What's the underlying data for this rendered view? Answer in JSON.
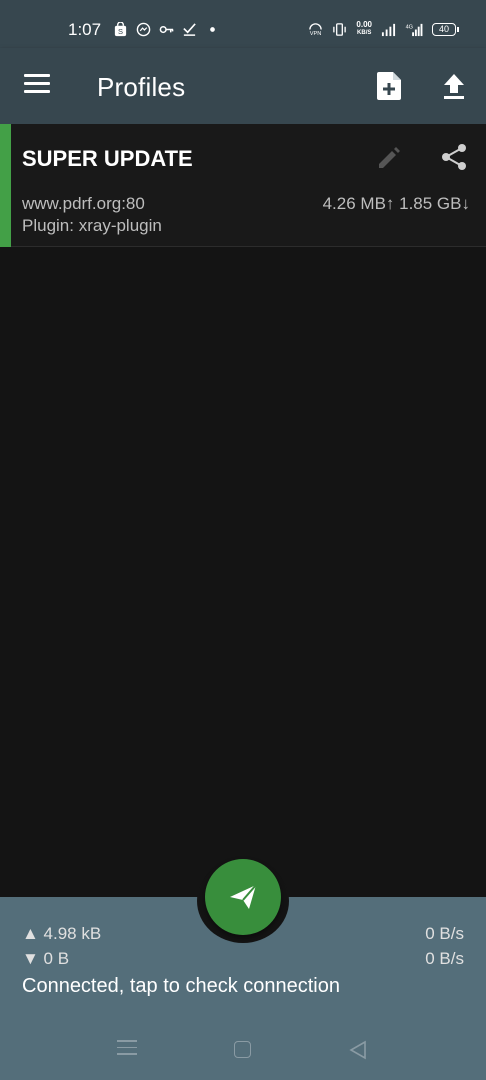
{
  "status_bar": {
    "time": "1:07",
    "net_speed_value": "0.00",
    "net_speed_unit": "KB/S",
    "battery": "40",
    "icons": [
      "bag-icon",
      "messenger-icon",
      "key-icon",
      "check-icon",
      "dot-icon",
      "vpn-icon",
      "vibrate-icon",
      "signal-icon",
      "4g-signal-icon",
      "battery-icon"
    ]
  },
  "app_bar": {
    "title": "Profiles",
    "icons": [
      "menu-icon",
      "add-file-icon",
      "upload-icon"
    ]
  },
  "profiles": [
    {
      "name": "SUPER UPDATE",
      "server": "www.pdrf.org:80",
      "plugin": "Plugin: xray-plugin",
      "traffic": "4.26 MB↑ 1.85 GB↓",
      "selected": true,
      "icons": [
        "edit-icon",
        "share-icon"
      ]
    }
  ],
  "stats": {
    "tx_total": "▲ 4.98 kB",
    "rx_total": "▼ 0 B",
    "tx_rate": "0 B/s",
    "rx_rate": "0 B/s",
    "status": "Connected, tap to check connection"
  },
  "fab": {
    "icon": "send-icon"
  },
  "nav_bar": {
    "icons": [
      "recents-icon",
      "home-icon",
      "back-icon"
    ]
  },
  "colors": {
    "toolbar": "#37474f",
    "panel": "#546e7a",
    "accent": "#43a047",
    "fab": "#388e3c",
    "background": "#141414"
  }
}
